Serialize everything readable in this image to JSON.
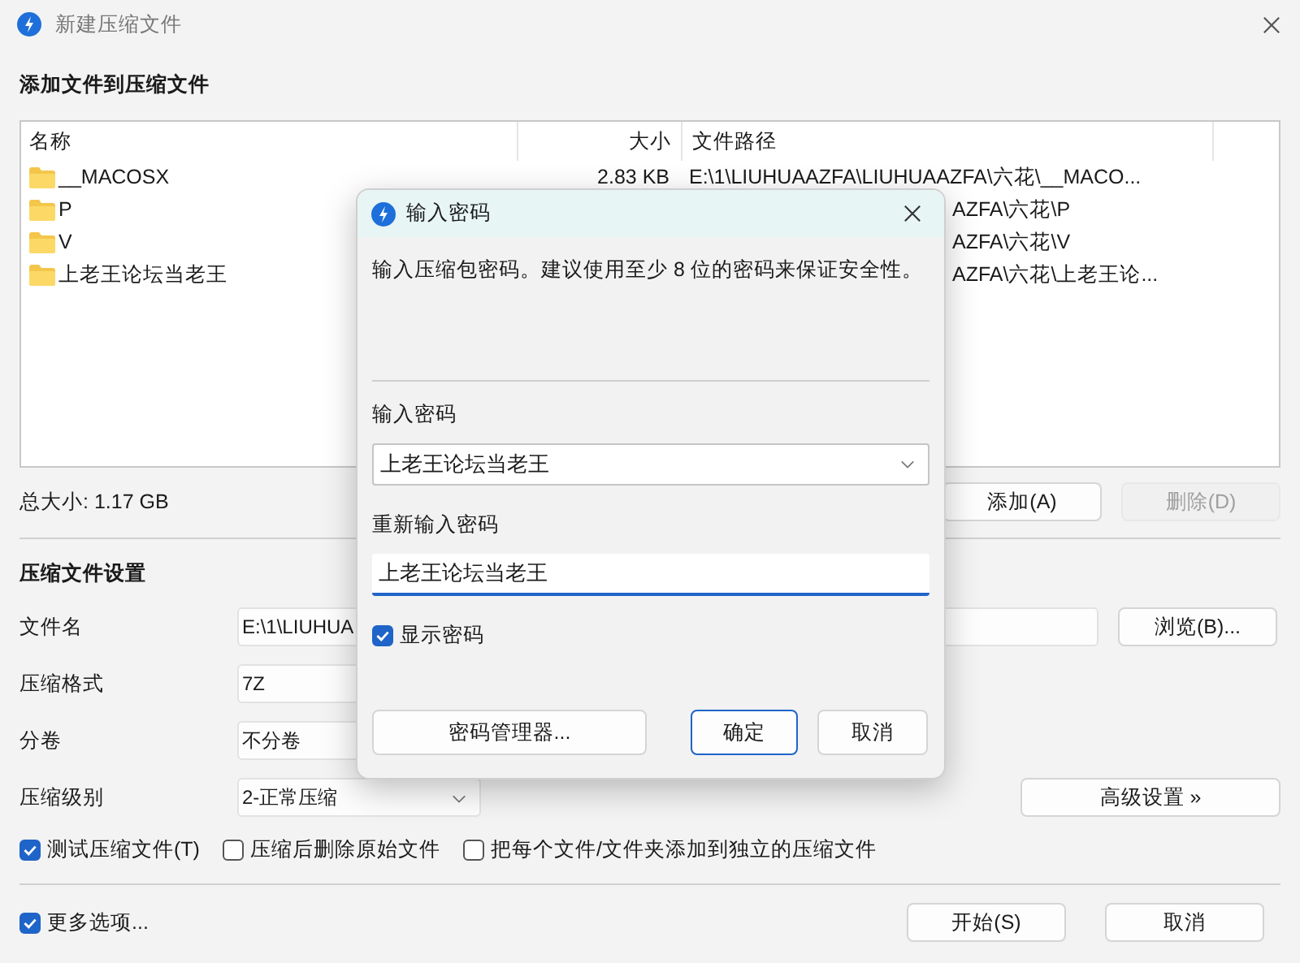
{
  "window": {
    "title": "新建压缩文件"
  },
  "files": {
    "heading": "添加文件到压缩文件",
    "columns": [
      "名称",
      "大小",
      "文件路径"
    ],
    "rows": [
      {
        "name": "__MACOSX",
        "size": "2.83 KB",
        "path": "E:\\1\\LIUHUAAZFA\\LIUHUAAZFA\\六花\\__MACO...",
        "partly_hidden": false
      },
      {
        "name": "P",
        "path": "AZFA\\六花\\P",
        "partly_hidden": true
      },
      {
        "name": "V",
        "path": "AZFA\\六花\\V",
        "partly_hidden": true
      },
      {
        "name": "上老王论坛当老王",
        "path": "AZFA\\六花\\上老王论...",
        "partly_hidden": true
      }
    ],
    "total_size": "总大小: 1.17 GB",
    "buttons": [
      {
        "label": "添加(A)",
        "disabled": false
      },
      {
        "label": "删除(D)",
        "disabled": true
      }
    ]
  },
  "settings": {
    "heading": "压缩文件设置",
    "fields": [
      {
        "kind": "text",
        "label": "文件名",
        "value": "E:\\1\\LIUHUA",
        "button": "浏览(B)..."
      },
      {
        "kind": "short",
        "label": "压缩格式",
        "value": "7Z"
      },
      {
        "kind": "short",
        "label": "分卷",
        "value": "不分卷"
      },
      {
        "kind": "select",
        "label": "压缩级别",
        "value": "2-正常压缩",
        "button": "高级设置 »"
      }
    ],
    "checkboxes": [
      {
        "label": "测试压缩文件(T)",
        "checked": true
      },
      {
        "label": "压缩后删除原始文件",
        "checked": false
      },
      {
        "label": "把每个文件/文件夹添加到独立的压缩文件",
        "checked": false
      }
    ]
  },
  "footer": {
    "more_options": {
      "label": "更多选项...",
      "checked": true
    },
    "buttons": [
      "开始(S)",
      "取消"
    ]
  },
  "dialog": {
    "title": "输入密码",
    "description": "输入压缩包密码。建议使用至少 8 位的密码来保证安全性。",
    "password_label": "输入密码",
    "password_value": "上老王论坛当老王",
    "confirm_label": "重新输入密码",
    "confirm_value": "上老王论坛当老王",
    "show_password": {
      "label": "显示密码",
      "checked": true
    },
    "buttons": [
      {
        "label": "密码管理器...",
        "default": false
      },
      {
        "label": "确定",
        "default": true
      },
      {
        "label": "取消",
        "default": false
      }
    ]
  }
}
